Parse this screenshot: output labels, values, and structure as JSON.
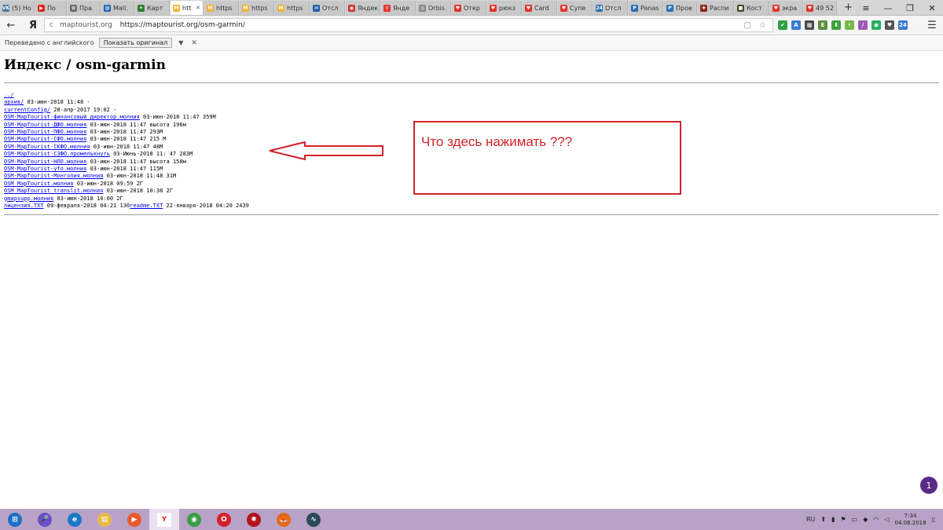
{
  "tabs": [
    {
      "label": "(5) Но",
      "color": "#4a76a8",
      "glyph": "VK"
    },
    {
      "label": "По",
      "color": "#e62117",
      "glyph": "▶"
    },
    {
      "label": "Пра",
      "color": "#6a6a6a",
      "glyph": "✿"
    },
    {
      "label": "Mail.",
      "color": "#1e63b8",
      "glyph": "@"
    },
    {
      "label": "Карт",
      "color": "#2e7d32",
      "glyph": "✦"
    },
    {
      "label": "htt",
      "color": "#f2b431",
      "glyph": "M",
      "active": true
    },
    {
      "label": "https",
      "color": "#f2b431",
      "glyph": "M"
    },
    {
      "label": "https",
      "color": "#f2b431",
      "glyph": "M"
    },
    {
      "label": "https",
      "color": "#f2b431",
      "glyph": "M"
    },
    {
      "label": "Отсл",
      "color": "#1f5fa8",
      "glyph": "✉"
    },
    {
      "label": "Яндек",
      "color": "#c9372c",
      "glyph": "◉"
    },
    {
      "label": "Янде",
      "color": "#e4322b",
      "glyph": "⚲"
    },
    {
      "label": "Orbis",
      "color": "#888888",
      "glyph": "◎"
    },
    {
      "label": "Откр",
      "color": "#e4322b",
      "glyph": "♥"
    },
    {
      "label": "рюкз",
      "color": "#e4322b",
      "glyph": "♥"
    },
    {
      "label": "Card",
      "color": "#e4322b",
      "glyph": "♥"
    },
    {
      "label": "Супе",
      "color": "#e4322b",
      "glyph": "♥"
    },
    {
      "label": "Отсл",
      "color": "#2b6fb5",
      "glyph": "24"
    },
    {
      "label": "Panas",
      "color": "#2b6fb5",
      "glyph": "P"
    },
    {
      "label": "Прое",
      "color": "#2b6fb5",
      "glyph": "P"
    },
    {
      "label": "Распи",
      "color": "#8b2020",
      "glyph": "✚"
    },
    {
      "label": "Кост",
      "color": "#3c4a2c",
      "glyph": "■"
    },
    {
      "label": "экра",
      "color": "#e4322b",
      "glyph": "♥"
    },
    {
      "label": "49 52",
      "color": "#e4322b",
      "glyph": "♥"
    }
  ],
  "new_tab_label": "+",
  "window_controls": {
    "menu": "≡",
    "minimize": "—",
    "restore": "❐",
    "close": "✕"
  },
  "address": {
    "back": "←",
    "ya": "Я",
    "reload": "c",
    "domain": "maptourist.org",
    "url": "https://maptourist.org/osm-garmin/",
    "bookmark_icon": "☆",
    "page_icon": "▢",
    "menu_dots": "☰"
  },
  "extensions": [
    {
      "color": "#2ea043",
      "glyph": "✔"
    },
    {
      "color": "#3a7bd5",
      "glyph": "A"
    },
    {
      "color": "#4a4a4a",
      "glyph": "▦"
    },
    {
      "color": "#5a8f3c",
      "glyph": "E"
    },
    {
      "color": "#3ea33e",
      "glyph": "⬇"
    },
    {
      "color": "#7ab648",
      "glyph": "⚡"
    },
    {
      "color": "#9b59b6",
      "glyph": "∕"
    },
    {
      "color": "#27ae60",
      "glyph": "◉"
    },
    {
      "color": "#555555",
      "glyph": "♥"
    },
    {
      "color": "#3a7bd5",
      "glyph": "24"
    }
  ],
  "translate_bar": {
    "text": "Переведено с английского",
    "show_original": "Показать оригинал",
    "arrow": "▼",
    "close": "✕"
  },
  "page": {
    "title": "Индекс / osm-garmin",
    "entries": [
      {
        "link": "../",
        "rest": ""
      },
      {
        "link": "архив/",
        "rest": " 03-июн-2018 11:48 -"
      },
      {
        "link": "currentConfig/",
        "rest": " 28-апр-2017 19:02 -"
      },
      {
        "link": "OSM-MapTourist-финансовый директор.молния",
        "rest": " 03-июн-2018 11:47 359M"
      },
      {
        "link": "OSM-MapTourist-ДФО.молния",
        "rest": " 03-июн-2018 11:47 высота 196м"
      },
      {
        "link": "OSM-MapTourist-ПФО.молния",
        "rest": " 03-июн-2018 11:47 293M"
      },
      {
        "link": "OSM-MapTourist-СФО.молния",
        "rest": " 03-июн-2018 11:47 215 М"
      },
      {
        "link": "OSM-MapTourist-СКФО.молния",
        "rest": " 03-июн-2018 11:47 48M"
      },
      {
        "link": "OSM-MapTourist-СЗФО.промелькнуть",
        "rest": " 03-Июнь-2018 11: 47 283M"
      },
      {
        "link": "OSM-MapTourist-НЛО.молния",
        "rest": " 03-июн-2018 11:47 высота 158м"
      },
      {
        "link": "OSM-MapTourist-уfo.молния",
        "rest": " 03-июн-2018 11:47 115M"
      },
      {
        "link": "OSM-MapTourist-Монголия.молния",
        "rest": " 03-июн-2018 11:48 31M"
      },
      {
        "link": "OSM_MapTourist.молния",
        "rest": " 03-июн-2018 09:59 2Г"
      },
      {
        "link": "OSM_MapTourist_translit.молния",
        "rest": " 03-июн-2018 10:38 2Г"
      },
      {
        "link": "gmapsupp.молния",
        "rest": " 03-июн-2018 10:00 2Г"
      }
    ],
    "last_line": {
      "link1": "лицензия.TXT",
      "rest1": " 09-февраля-2018 04:21 130",
      "link2": "readme.TXT",
      "rest2": " 22-января-2018 04:20 2439"
    }
  },
  "annotation": {
    "text": "Что здесь нажимать ???",
    "color": "#d2232a"
  },
  "chat_badge": "1",
  "taskbar": {
    "items": [
      {
        "name": "start-button",
        "color": "#1d6fc4",
        "glyph": "⊞"
      },
      {
        "name": "voice-assistant",
        "color": "#6a4fc9",
        "glyph": "🎤"
      },
      {
        "name": "ie",
        "color": "#1b79c7",
        "glyph": "e"
      },
      {
        "name": "explorer",
        "color": "#e9b949",
        "glyph": "▤"
      },
      {
        "name": "media-player",
        "color": "#e85a2c",
        "glyph": "▶"
      },
      {
        "name": "yandex-browser",
        "color": "#e4322b",
        "glyph": "Y"
      },
      {
        "name": "chrome",
        "color": "#3b9c45",
        "glyph": "◉"
      },
      {
        "name": "opera",
        "color": "#d4202a",
        "glyph": "O"
      },
      {
        "name": "app-red",
        "color": "#b3141c",
        "glyph": "✺"
      },
      {
        "name": "firefox",
        "color": "#e66a1d",
        "glyph": "🦊"
      },
      {
        "name": "stocks-app",
        "color": "#2a4a5a",
        "glyph": "∿"
      }
    ],
    "lang": "RU",
    "time": "7:34",
    "date": "04.06.2018"
  }
}
